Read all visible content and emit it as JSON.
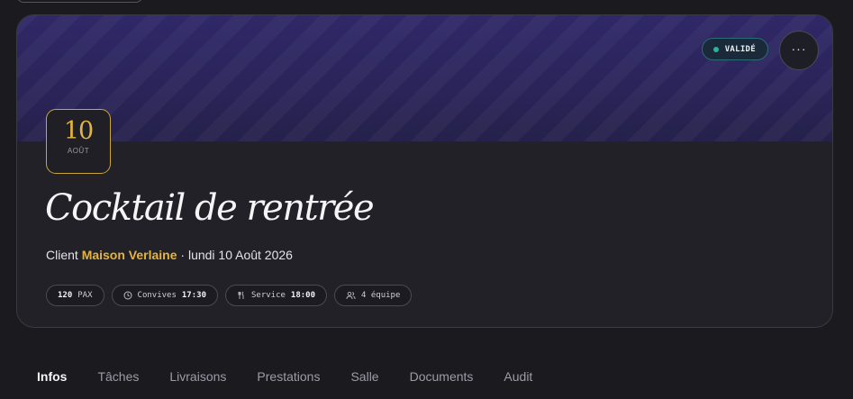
{
  "event": {
    "status": "VALIDÉ",
    "date_day": "10",
    "date_month": "AOÛT",
    "title": "Cocktail de rentrée",
    "client_prefix": "Client",
    "client_name": "Maison Verlaine",
    "date_full": "· lundi 10 Août 2026",
    "more_label": "···"
  },
  "chips": {
    "pax_value": "120",
    "pax_label": "PAX",
    "guests_label": "Convives",
    "guests_time": "17:30",
    "service_label": "Service",
    "service_time": "18:00",
    "team_label": "4 équipe"
  },
  "icons": {
    "guests": "clock-icon",
    "service": "cutlery-icon",
    "team": "users-icon"
  },
  "tabs": [
    {
      "label": "Infos",
      "active": true
    },
    {
      "label": "Tâches"
    },
    {
      "label": "Livraisons"
    },
    {
      "label": "Prestations"
    },
    {
      "label": "Salle"
    },
    {
      "label": "Documents"
    },
    {
      "label": "Audit"
    }
  ],
  "colors": {
    "accent": "#e4b53e",
    "status_dot": "#2bb39c",
    "banner": "#2f2868",
    "background": "#1a1a1f"
  }
}
